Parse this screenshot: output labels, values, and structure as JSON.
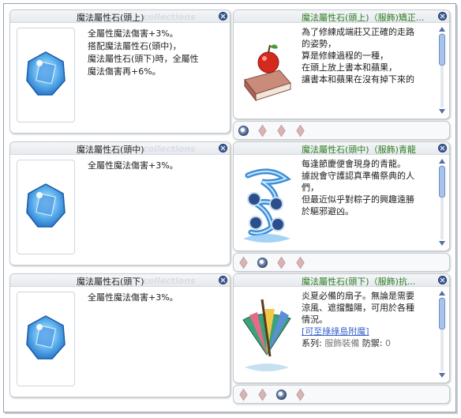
{
  "rows": [
    {
      "left": {
        "title": "魔法屬性石(頭上)",
        "watermark": "collections",
        "lines": [
          "全屬性魔法傷害+3%。",
          "搭配魔法屬性石(頭中)，",
          "魔法屬性石(頭下)時，全屬性",
          "魔法傷害再+6%。"
        ]
      },
      "right": {
        "title": "魔法屬性石(頭上)（服飾)矯正...",
        "lines": [
          "為了修練成端莊又正確的走路",
          "的姿勢，",
          "算是修練過程的一種，",
          "在頭上放上書本和蘋果，",
          "讓書本和蘋果在沒有掉下來的"
        ],
        "icon": "book-apple-icon"
      },
      "dots": [
        "on",
        "off",
        "off",
        "off"
      ]
    },
    {
      "left": {
        "title": "魔法屬性石(頭中)",
        "watermark": "collections",
        "lines": [
          "全屬性魔法傷害+3%。"
        ]
      },
      "right": {
        "title": "魔法屬性石(頭中)（服飾)青龍",
        "lines": [
          "每逢節慶便會現身的青龍。",
          "據說會守護認真準備祭典的人",
          "們，",
          "但最近似乎對粽子的興趣遠勝",
          "於驅邪避凶。"
        ],
        "icon": "blue-dragon-icon"
      },
      "dots": [
        "off",
        "on",
        "off",
        "off"
      ]
    },
    {
      "left": {
        "title": "魔法屬性石(頭下)",
        "watermark": "collections",
        "lines": [
          "全屬性魔法傷害+3%。"
        ]
      },
      "right": {
        "title": "魔法屬性石(頭下)（服飾)抗...",
        "lines": [
          "炎夏必備的扇子。無論是需要",
          "涼風、遮擋豔陽，可用於各種",
          "情況。"
        ],
        "link": "[可至綠綠島附魔]",
        "series_label": "系列:",
        "series_value": "服飾裝備",
        "def_label": "防禦:",
        "def_value": "0",
        "icon": "paper-fan-icon"
      },
      "dots": [
        "off",
        "off",
        "on",
        "off"
      ]
    }
  ],
  "colors": {
    "accent_green": "#2e7d21",
    "link_blue": "#3a63c8",
    "close_button": "#3e5f9a"
  }
}
